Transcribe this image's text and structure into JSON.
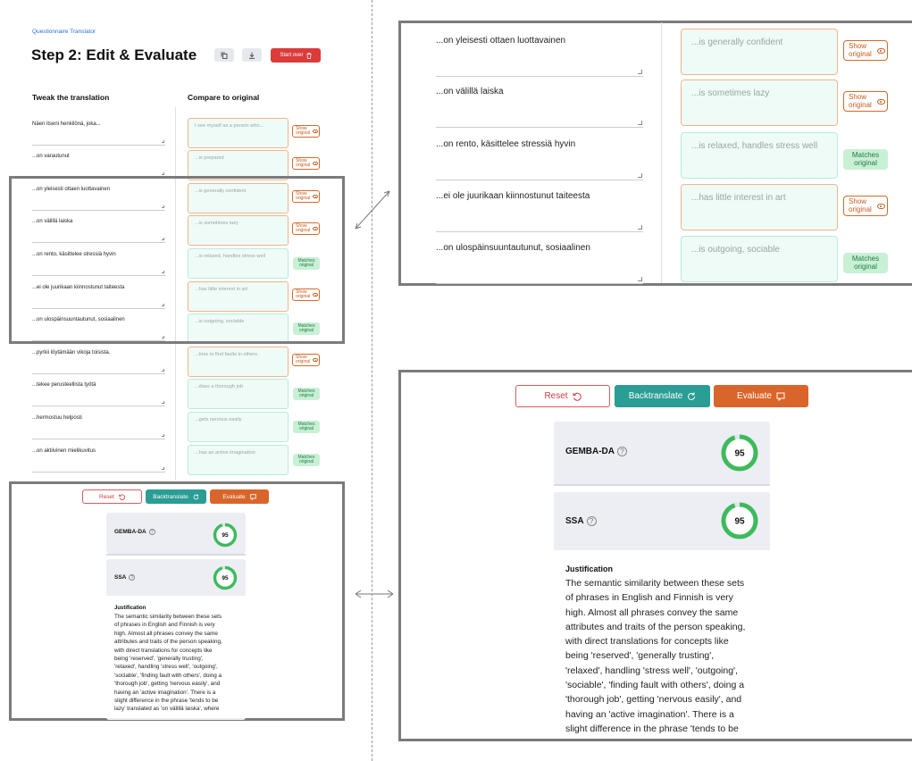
{
  "app": {
    "subtitle": "Questionnaire Translator",
    "step_title": "Step 2: Edit & Evaluate",
    "start_over_label": "Start over"
  },
  "columns": {
    "left_heading": "Tweak the translation",
    "right_heading": "Compare to original"
  },
  "rows": [
    {
      "phrase": "Näen itseni henkilönä, joka...",
      "back": "I see myself as a person who...",
      "status": "Show original"
    },
    {
      "phrase": "...on varautunut",
      "back": "...is prepared",
      "status": "Show original"
    },
    {
      "phrase": "...on yleisesti ottaen luottavainen",
      "back": "...is generally confident",
      "status": "Show original"
    },
    {
      "phrase": "...on välillä laiska",
      "back": "...is sometimes lazy",
      "status": "Show original"
    },
    {
      "phrase": "...on rento, käsittelee stressiä hyvin",
      "back": "...is relaxed, handles stress well",
      "status": "Matches original"
    },
    {
      "phrase": "...ei ole juurikaan kiinnostunut taiteesta",
      "back": "...has little interest in art",
      "status": "Show original"
    },
    {
      "phrase": "...on ulospäinsuuntautunut, sosiaalinen",
      "back": "...is outgoing, sociable",
      "status": "Matches original"
    },
    {
      "phrase": "...pyrkii löytämään vikoja toisista.",
      "back": "...tries to find faults in others.",
      "status": "Show original"
    },
    {
      "phrase": "...tekee perusteellista työtä",
      "back": "...does a thorough job",
      "status": "Matches original"
    },
    {
      "phrase": "...hermostuu helposti",
      "back": "...gets nervous easily",
      "status": "Matches original"
    },
    {
      "phrase": "...on aktiivinen mielikuvitus",
      "back": "...has an active imagination",
      "status": "Matches original"
    }
  ],
  "status_labels": {
    "show_line1": "Show",
    "show_line2": "original",
    "match_line1": "Matches",
    "match_line2": "original"
  },
  "actions": {
    "reset": "Reset",
    "backtranslate": "Backtranslate",
    "evaluate": "Evaluate"
  },
  "metrics": [
    {
      "name": "GEMBA-DA",
      "score": 95,
      "score_fraction": 0.95
    },
    {
      "name": "SSA",
      "score": 95,
      "score_fraction": 0.95
    }
  ],
  "justification": {
    "title": "Justification",
    "small_lines": [
      "The semantic similarity between these sets",
      "of phrases in English and Finnish is very",
      "high. Almost all phrases convey the same",
      "attributes and traits of the person speaking,",
      "with direct translations for concepts like",
      "being 'reserved', 'generally trusting',",
      "'relaxed', handling 'stress well', 'outgoing',",
      "'sociable', 'finding fault with others', doing a",
      "'thorough job', getting 'nervous easily', and",
      "having an 'active imagination'. There is a",
      "slight difference in the phrase 'tends to be",
      "lazy' translated as 'on välillä laiska', where"
    ],
    "large_lines": [
      "The semantic similarity between these sets",
      "of phrases in English and Finnish is very",
      "high. Almost all phrases convey the same",
      "attributes and traits of the person speaking,",
      "with direct translations for concepts like",
      "being 'reserved', 'generally trusting',",
      "'relaxed', handling 'stress well', 'outgoing',",
      "'sociable', 'finding fault with others', doing a",
      "'thorough job', getting 'nervous easily', and",
      "having an 'active imagination'. There is a",
      "slight difference in the phrase 'tends to be",
      "lazy' translated as 'on välillä laiska', where"
    ]
  },
  "colors": {
    "accent_red": "#dc3b3b",
    "teal": "#2a9d94",
    "orange": "#d9652a",
    "match_green": "#c8f0d5",
    "gauge_green": "#3dbb5c"
  }
}
